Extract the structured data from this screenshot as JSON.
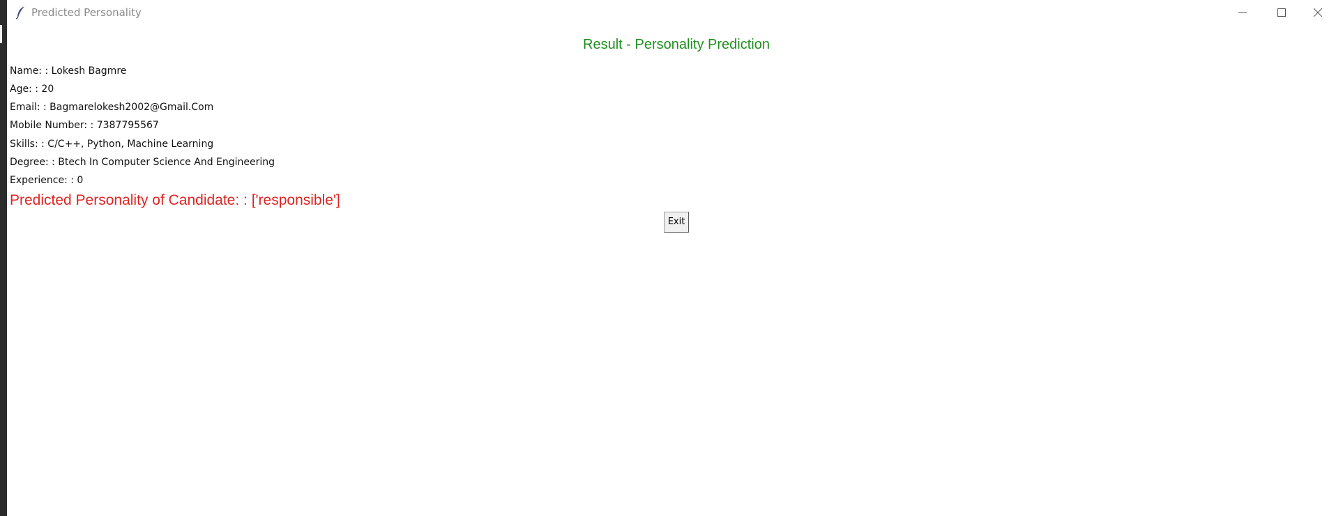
{
  "window": {
    "title": "Predicted Personality",
    "icon": "feather-icon"
  },
  "heading": "Result - Personality Prediction",
  "details": [
    {
      "label": "Name:",
      "value": ": Lokesh Bagmre"
    },
    {
      "label": "Age:",
      "value": ": 20"
    },
    {
      "label": "Email:",
      "value": ": Bagmarelokesh2002@Gmail.Com"
    },
    {
      "label": "Mobile Number:",
      "value": ": 7387795567"
    },
    {
      "label": "Skills:",
      "value": ": C/C++, Python, Machine Learning"
    },
    {
      "label": "Degree:",
      "value": ": Btech In Computer Science And Engineering"
    },
    {
      "label": "Experience:",
      "value": ": 0"
    }
  ],
  "prediction": {
    "label": "Predicted Personality of Candidate:",
    "value": ": ['responsible']"
  },
  "exit_button": "Exit",
  "colors": {
    "heading": "#1f8f1f",
    "prediction": "#e02424",
    "text": "#111111"
  }
}
